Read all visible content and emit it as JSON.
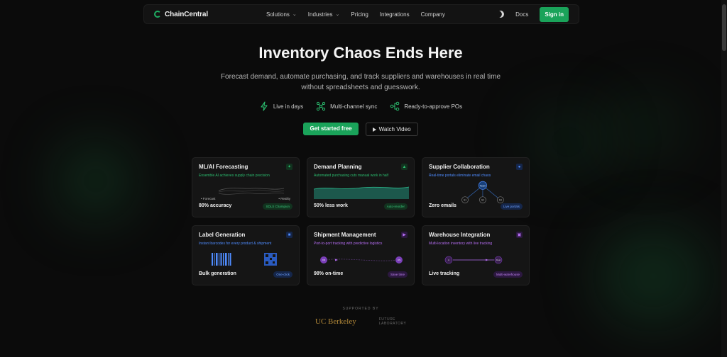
{
  "nav": {
    "logo": "ChainCentral",
    "menu": [
      "Solutions",
      "Industries",
      "Pricing",
      "Integrations",
      "Company"
    ],
    "docs": "Docs",
    "signin": "Sign in"
  },
  "hero": {
    "title": "Inventory Chaos Ends Here",
    "subtitle_line1": "Forecast demand, automate purchasing, and track suppliers and warehouses in real time",
    "subtitle_line2": "without spreadsheets and guesswork.",
    "features": [
      "Live in days",
      "Multi-channel sync",
      "Ready-to-approve POs"
    ],
    "cta_primary": "Get started free",
    "cta_secondary": "Watch Video"
  },
  "cards": [
    {
      "title": "ML/AI Forecasting",
      "desc": "Ensemble AI achieves supply chain precision",
      "stat": "80% accuracy",
      "badge": "SDLS Champion",
      "labels": [
        "• Forecast",
        "• Reality"
      ]
    },
    {
      "title": "Demand Planning",
      "desc": "Automated purchasing cuts manual work in half",
      "stat": "50% less work",
      "badge": "Auto-reorder"
    },
    {
      "title": "Supplier Collaboration",
      "desc": "Real-time portals eliminate email chaos",
      "stat": "Zero emails",
      "badge": "Live portals",
      "nodes": [
        "Team",
        "S1",
        "S2",
        "S3"
      ]
    },
    {
      "title": "Label Generation",
      "desc": "Instant barcodes for every product & shipment",
      "stat": "Bulk generation",
      "badge": "One-click"
    },
    {
      "title": "Shipment Management",
      "desc": "Port-to-port tracking with predictive logistics",
      "stat": "98% on-time",
      "badge": "Save time",
      "nodes": [
        "CN",
        "US"
      ]
    },
    {
      "title": "Warehouse Integration",
      "desc": "Multi-location inventory with live tracking",
      "stat": "Live tracking",
      "badge": "Multi-warehouse",
      "nodes": [
        "A",
        "Dest"
      ]
    }
  ],
  "footer": {
    "supported_by": "SUPPORTED BY",
    "logo1": "UC Berkeley",
    "logo2_line1": "FUTURE",
    "logo2_line2": "LABORATORY"
  },
  "colors": {
    "accent": "#1aa35a",
    "blue": "#4f8cff",
    "purple": "#b46cf0",
    "background": "#0b0b0b"
  },
  "icons": [
    "logo-icon",
    "chevron-down-icon",
    "moon-icon",
    "bolt-icon",
    "network-icon",
    "workflow-icon",
    "play-icon",
    "sparkle-icon",
    "chart-icon",
    "users-icon",
    "box-icon",
    "truck-icon",
    "warehouse-icon"
  ]
}
